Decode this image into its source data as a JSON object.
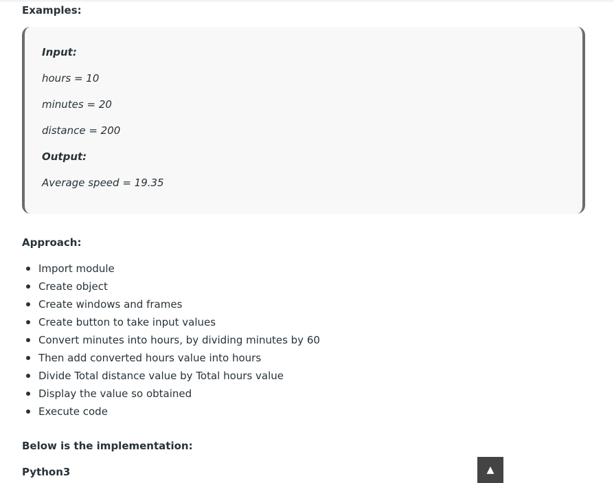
{
  "examples": {
    "heading": "Examples:",
    "input_label": "Input:",
    "input_lines": [
      "hours = 10",
      "minutes = 20",
      "distance = 200"
    ],
    "output_label": "Output:",
    "output_line": "Average speed = 19.35"
  },
  "approach": {
    "heading": "Approach:",
    "steps": [
      "Import module",
      "Create object",
      "Create windows and frames",
      "Create button to take input values",
      "Convert minutes into hours, by dividing minutes by 60",
      "Then add converted hours value into hours",
      "Divide Total distance value by Total hours value",
      "Display the value so obtained",
      "Execute code"
    ]
  },
  "implementation": {
    "heading": "Below is the implementation:",
    "language": "Python3"
  },
  "scroll_top": {
    "icon": "arrow-up-icon",
    "glyph": "▲"
  }
}
